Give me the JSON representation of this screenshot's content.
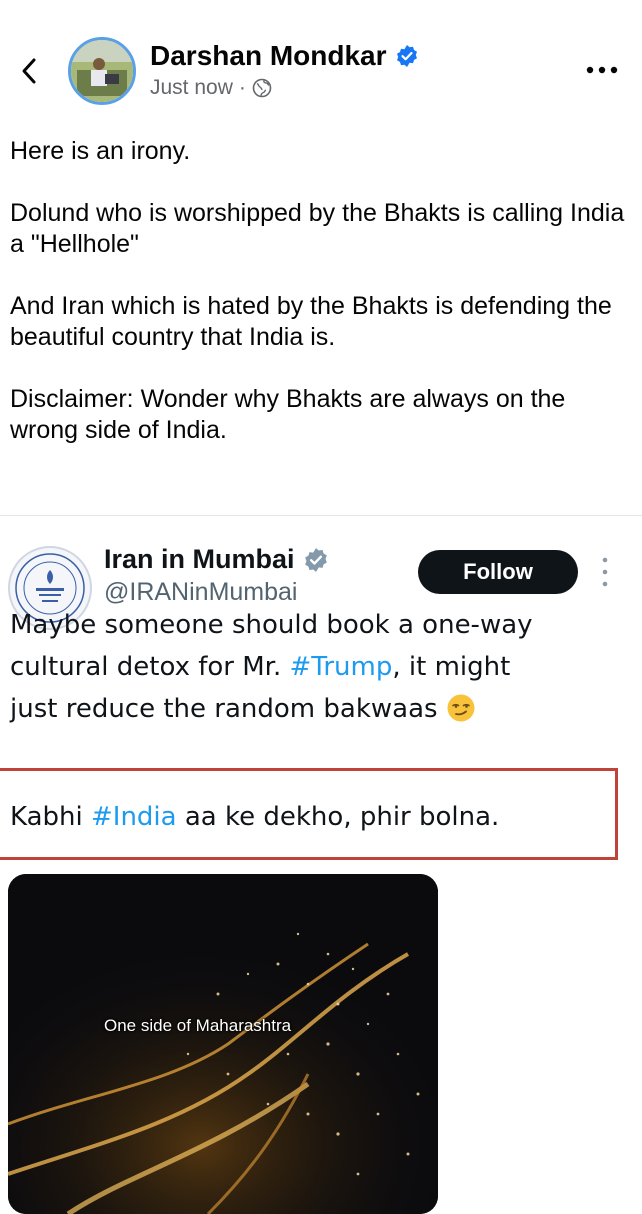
{
  "header": {
    "back_icon": "chevron-left-icon",
    "author_name": "Darshan Mondkar",
    "timestamp": "Just now",
    "separator": "·",
    "privacy_icon": "globe-icon",
    "more_icon": "more-horizontal-icon"
  },
  "post": {
    "paragraphs": [
      "Here is an irony.",
      "Dolund who is worshipped by the Bhakts is calling India a \"Hellhole\"",
      "And Iran which is hated by the Bhakts is defending the beautiful country that India is.",
      "Disclaimer: Wonder why Bhakts are always on the wrong side of India."
    ]
  },
  "embed": {
    "name": "Iran in Mumbai",
    "handle": "@IRANinMumbai",
    "follow_label": "Follow",
    "line1": "Maybe someone should book a one-way",
    "line2_pre": "cultural detox for Mr. ",
    "line2_tag": "#Trump",
    "line2_post": ", it might",
    "line3": "just reduce the random bakwaas ",
    "emoji": "smirk-emoji",
    "line4_pre": "Kabhi ",
    "line4_tag": "#India",
    "line4_post": " aa ke dekho, phir bolna.",
    "video_caption": "One side of Maharashtra"
  },
  "colors": {
    "verified_blue": "#1877f2",
    "hashtag_blue": "#1d9bf0",
    "highlight_red": "#c0433a"
  }
}
